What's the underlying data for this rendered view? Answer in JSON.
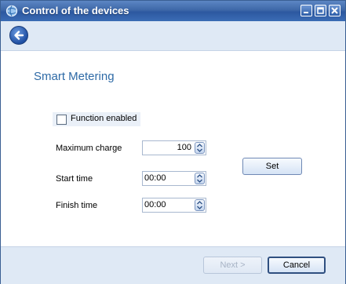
{
  "window": {
    "title": "Control of the devices",
    "icon": "globe-icon",
    "controls": [
      "minimize-icon",
      "maximize-icon",
      "close-icon"
    ]
  },
  "toolbar": {
    "back_icon": "back-arrow-icon"
  },
  "main": {
    "heading": "Smart Metering",
    "function_enabled": {
      "label": "Function enabled",
      "checked": false
    },
    "maximum_charge": {
      "label": "Maximum charge",
      "value": "100"
    },
    "start_time": {
      "label": "Start time",
      "value": "00:00"
    },
    "finish_time": {
      "label": "Finish time",
      "value": "00:00"
    },
    "set_button": "Set"
  },
  "footer": {
    "next_button": "Next >",
    "cancel_button": "Cancel"
  },
  "colors": {
    "title_bar": "#3e68a8",
    "heading": "#2e6aa6",
    "panel": "#dfe9f5"
  }
}
